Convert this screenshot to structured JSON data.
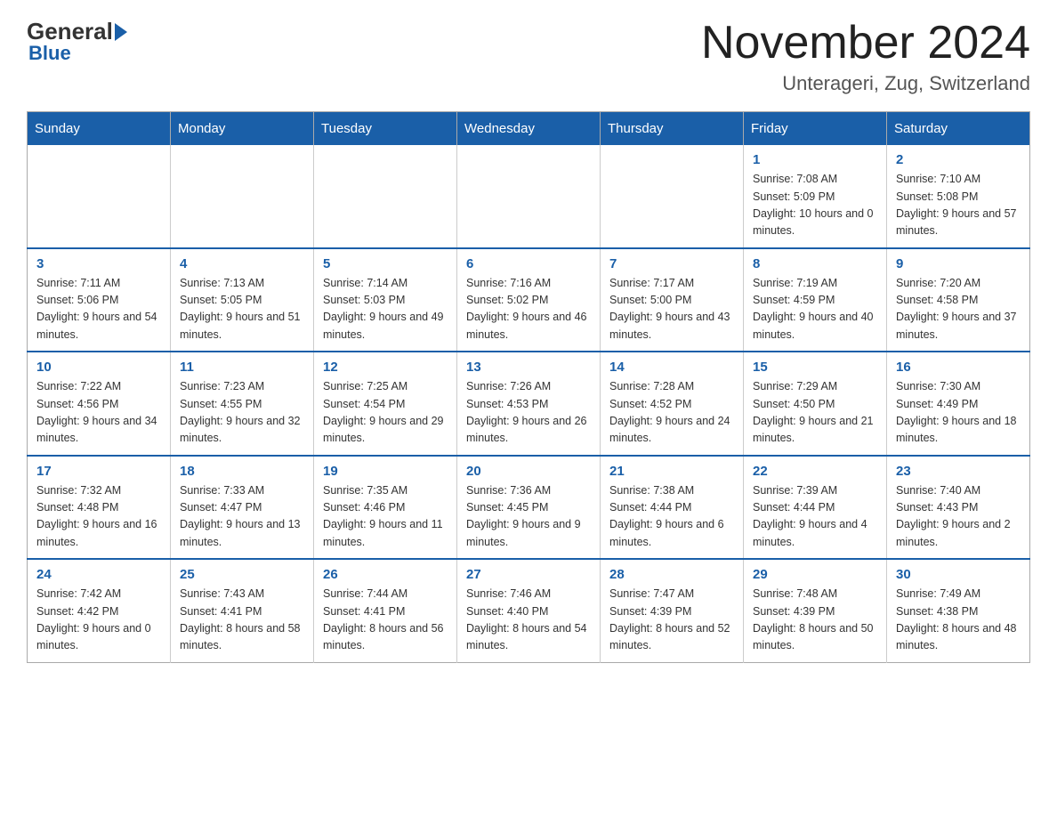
{
  "header": {
    "logo_general": "General",
    "logo_blue": "Blue",
    "month_title": "November 2024",
    "location": "Unterageri, Zug, Switzerland"
  },
  "days_of_week": [
    "Sunday",
    "Monday",
    "Tuesday",
    "Wednesday",
    "Thursday",
    "Friday",
    "Saturday"
  ],
  "weeks": [
    {
      "days": [
        {
          "number": "",
          "info": ""
        },
        {
          "number": "",
          "info": ""
        },
        {
          "number": "",
          "info": ""
        },
        {
          "number": "",
          "info": ""
        },
        {
          "number": "",
          "info": ""
        },
        {
          "number": "1",
          "info": "Sunrise: 7:08 AM\nSunset: 5:09 PM\nDaylight: 10 hours and 0 minutes."
        },
        {
          "number": "2",
          "info": "Sunrise: 7:10 AM\nSunset: 5:08 PM\nDaylight: 9 hours and 57 minutes."
        }
      ]
    },
    {
      "days": [
        {
          "number": "3",
          "info": "Sunrise: 7:11 AM\nSunset: 5:06 PM\nDaylight: 9 hours and 54 minutes."
        },
        {
          "number": "4",
          "info": "Sunrise: 7:13 AM\nSunset: 5:05 PM\nDaylight: 9 hours and 51 minutes."
        },
        {
          "number": "5",
          "info": "Sunrise: 7:14 AM\nSunset: 5:03 PM\nDaylight: 9 hours and 49 minutes."
        },
        {
          "number": "6",
          "info": "Sunrise: 7:16 AM\nSunset: 5:02 PM\nDaylight: 9 hours and 46 minutes."
        },
        {
          "number": "7",
          "info": "Sunrise: 7:17 AM\nSunset: 5:00 PM\nDaylight: 9 hours and 43 minutes."
        },
        {
          "number": "8",
          "info": "Sunrise: 7:19 AM\nSunset: 4:59 PM\nDaylight: 9 hours and 40 minutes."
        },
        {
          "number": "9",
          "info": "Sunrise: 7:20 AM\nSunset: 4:58 PM\nDaylight: 9 hours and 37 minutes."
        }
      ]
    },
    {
      "days": [
        {
          "number": "10",
          "info": "Sunrise: 7:22 AM\nSunset: 4:56 PM\nDaylight: 9 hours and 34 minutes."
        },
        {
          "number": "11",
          "info": "Sunrise: 7:23 AM\nSunset: 4:55 PM\nDaylight: 9 hours and 32 minutes."
        },
        {
          "number": "12",
          "info": "Sunrise: 7:25 AM\nSunset: 4:54 PM\nDaylight: 9 hours and 29 minutes."
        },
        {
          "number": "13",
          "info": "Sunrise: 7:26 AM\nSunset: 4:53 PM\nDaylight: 9 hours and 26 minutes."
        },
        {
          "number": "14",
          "info": "Sunrise: 7:28 AM\nSunset: 4:52 PM\nDaylight: 9 hours and 24 minutes."
        },
        {
          "number": "15",
          "info": "Sunrise: 7:29 AM\nSunset: 4:50 PM\nDaylight: 9 hours and 21 minutes."
        },
        {
          "number": "16",
          "info": "Sunrise: 7:30 AM\nSunset: 4:49 PM\nDaylight: 9 hours and 18 minutes."
        }
      ]
    },
    {
      "days": [
        {
          "number": "17",
          "info": "Sunrise: 7:32 AM\nSunset: 4:48 PM\nDaylight: 9 hours and 16 minutes."
        },
        {
          "number": "18",
          "info": "Sunrise: 7:33 AM\nSunset: 4:47 PM\nDaylight: 9 hours and 13 minutes."
        },
        {
          "number": "19",
          "info": "Sunrise: 7:35 AM\nSunset: 4:46 PM\nDaylight: 9 hours and 11 minutes."
        },
        {
          "number": "20",
          "info": "Sunrise: 7:36 AM\nSunset: 4:45 PM\nDaylight: 9 hours and 9 minutes."
        },
        {
          "number": "21",
          "info": "Sunrise: 7:38 AM\nSunset: 4:44 PM\nDaylight: 9 hours and 6 minutes."
        },
        {
          "number": "22",
          "info": "Sunrise: 7:39 AM\nSunset: 4:44 PM\nDaylight: 9 hours and 4 minutes."
        },
        {
          "number": "23",
          "info": "Sunrise: 7:40 AM\nSunset: 4:43 PM\nDaylight: 9 hours and 2 minutes."
        }
      ]
    },
    {
      "days": [
        {
          "number": "24",
          "info": "Sunrise: 7:42 AM\nSunset: 4:42 PM\nDaylight: 9 hours and 0 minutes."
        },
        {
          "number": "25",
          "info": "Sunrise: 7:43 AM\nSunset: 4:41 PM\nDaylight: 8 hours and 58 minutes."
        },
        {
          "number": "26",
          "info": "Sunrise: 7:44 AM\nSunset: 4:41 PM\nDaylight: 8 hours and 56 minutes."
        },
        {
          "number": "27",
          "info": "Sunrise: 7:46 AM\nSunset: 4:40 PM\nDaylight: 8 hours and 54 minutes."
        },
        {
          "number": "28",
          "info": "Sunrise: 7:47 AM\nSunset: 4:39 PM\nDaylight: 8 hours and 52 minutes."
        },
        {
          "number": "29",
          "info": "Sunrise: 7:48 AM\nSunset: 4:39 PM\nDaylight: 8 hours and 50 minutes."
        },
        {
          "number": "30",
          "info": "Sunrise: 7:49 AM\nSunset: 4:38 PM\nDaylight: 8 hours and 48 minutes."
        }
      ]
    }
  ]
}
